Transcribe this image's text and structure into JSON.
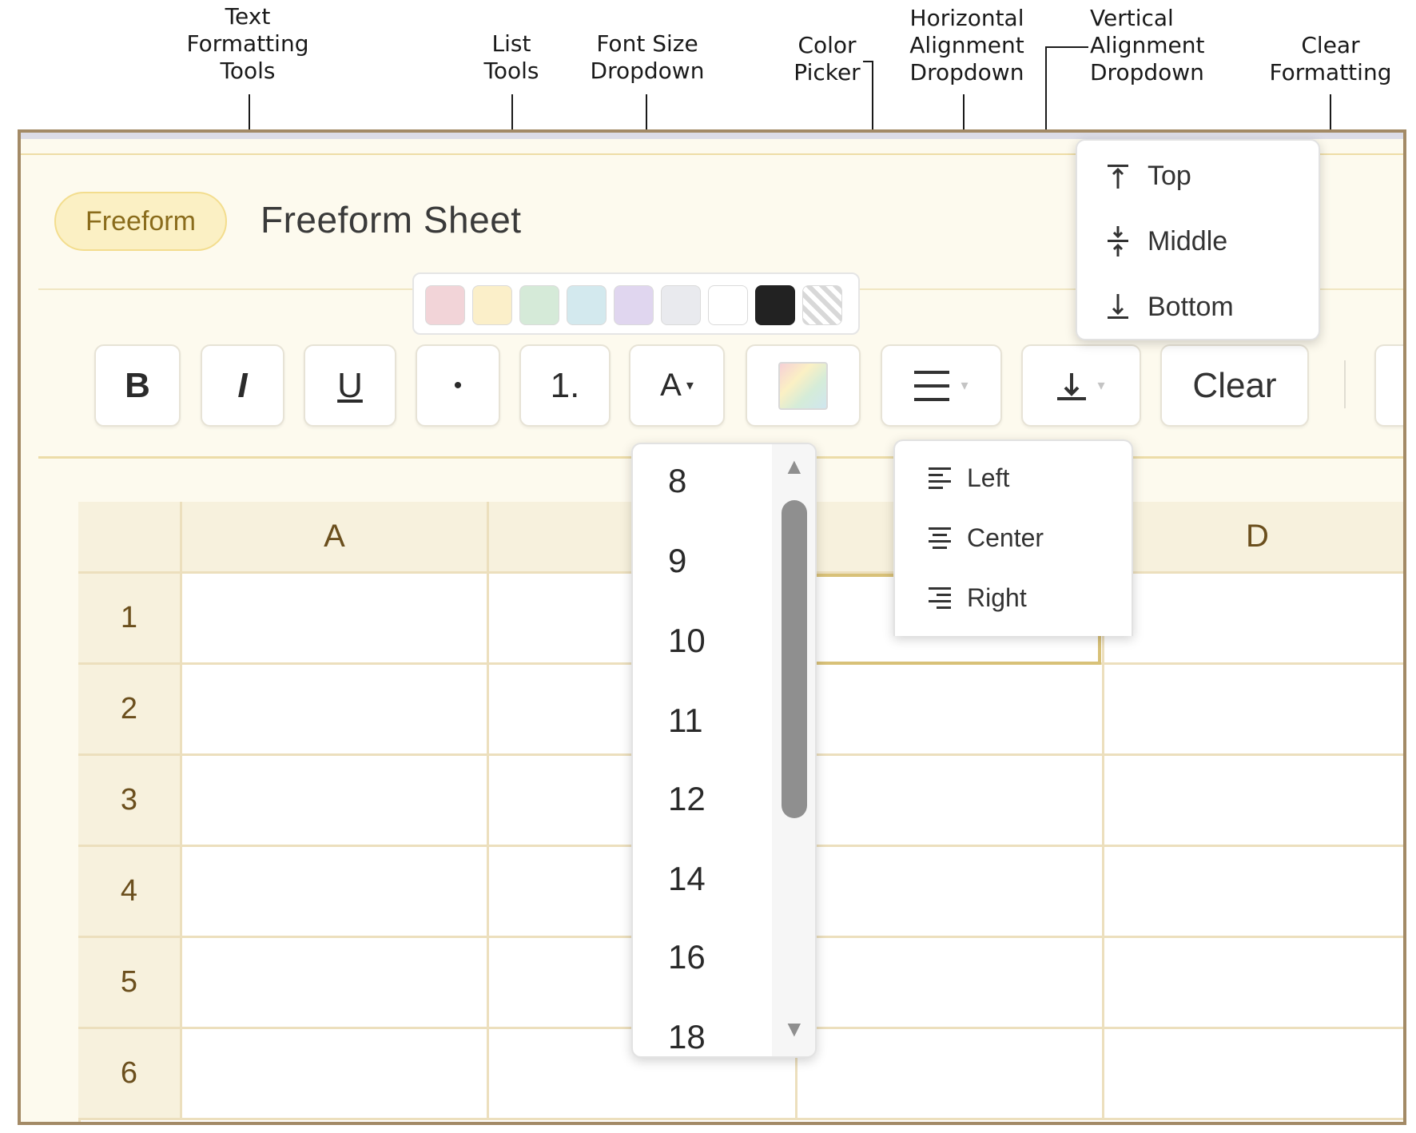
{
  "annotations": {
    "text_formatting": "Text\nFormatting\nTools",
    "list_tools": "List\nTools",
    "font_size": "Font Size\nDropdown",
    "color_picker": "Color\nPicker",
    "horizontal_alignment": "Horizontal\nAlignment\nDropdown",
    "vertical_alignment": "Vertical\nAlignment\nDropdown",
    "clear_formatting": "Clear\nFormatting"
  },
  "header": {
    "mode_badge": "Freeform",
    "title": "Freeform Sheet"
  },
  "toolbar": {
    "bold": "B",
    "italic": "I",
    "underline": "U",
    "bullet_list": "•",
    "numbered_list": "1.",
    "font_size": "A",
    "clear": "Clear"
  },
  "color_swatches": [
    "#f2d4d8",
    "#fbefc9",
    "#d5ead8",
    "#d3e9ee",
    "#e0d6ef",
    "#e9eaee",
    "#ffffff",
    "#222222",
    "none"
  ],
  "font_size_dropdown": {
    "options": [
      "8",
      "9",
      "10",
      "11",
      "12",
      "14",
      "16",
      "18"
    ]
  },
  "vertical_alignment_dropdown": {
    "options": [
      "Top",
      "Middle",
      "Bottom"
    ]
  },
  "horizontal_alignment_dropdown": {
    "options": [
      "Left",
      "Center",
      "Right"
    ]
  },
  "sheet": {
    "columns": [
      "A",
      "",
      "",
      "D"
    ],
    "rows": [
      "1",
      "2",
      "3",
      "4",
      "5",
      "6"
    ]
  },
  "colors": {
    "frame_border": "#a38a66",
    "grid_line": "#ecdfbd",
    "header_fill": "#f7f1dd",
    "accent": "#d8c178"
  }
}
